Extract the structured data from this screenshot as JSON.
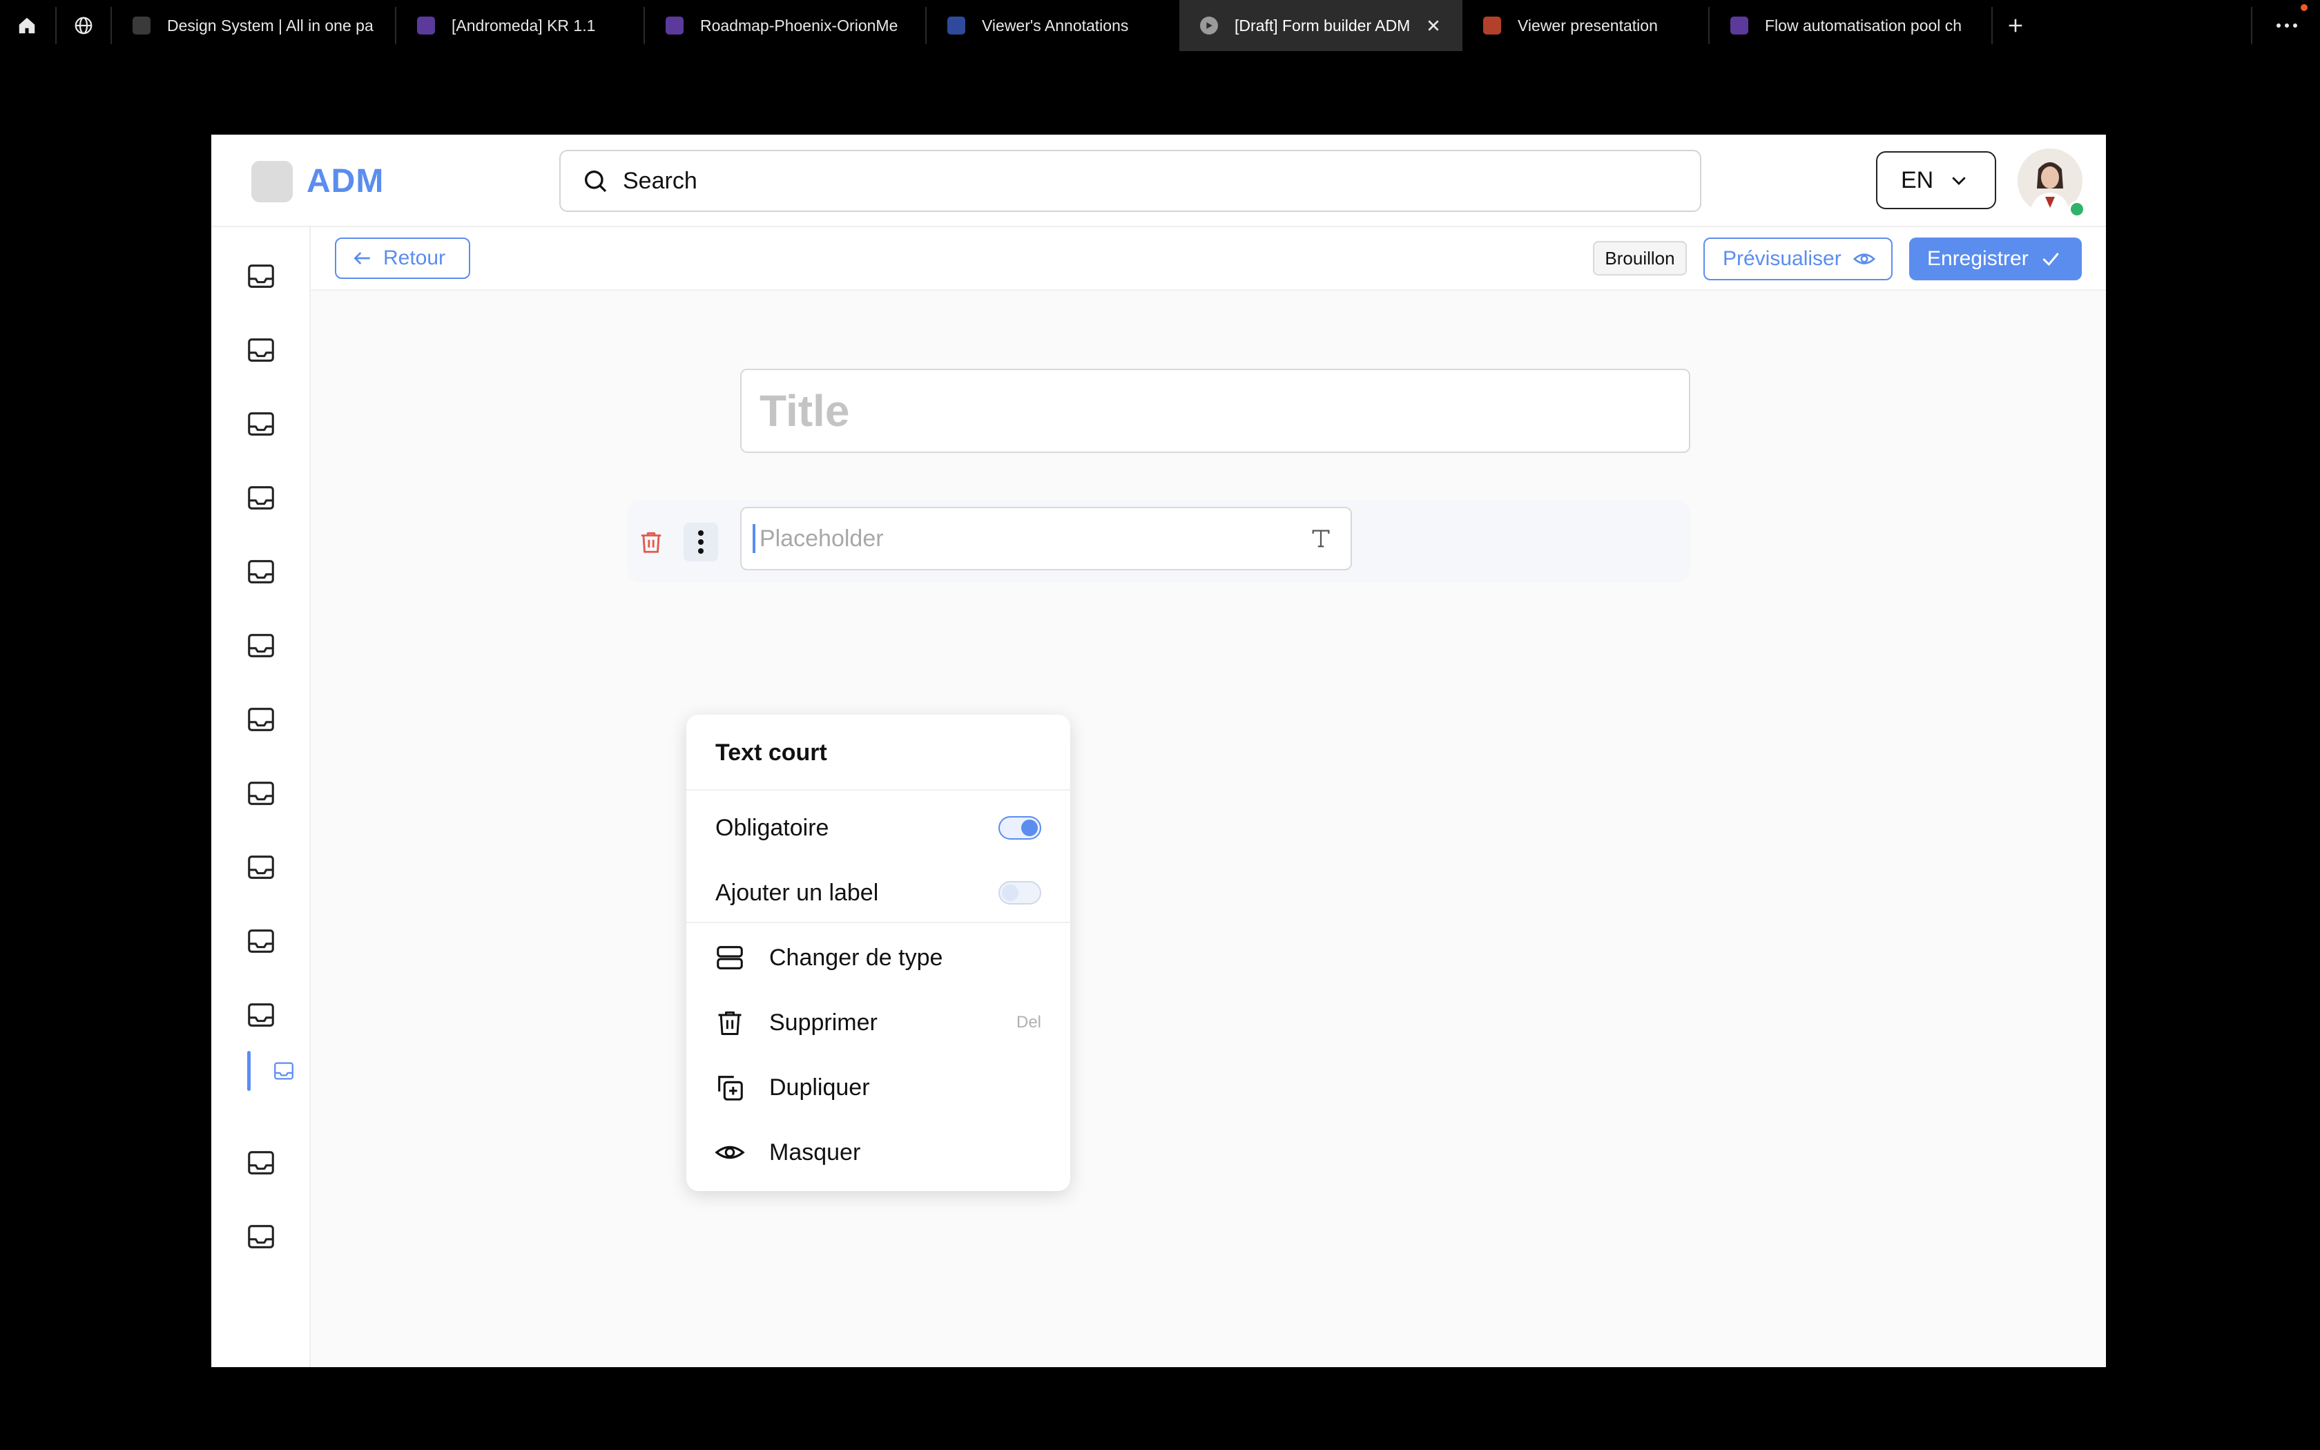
{
  "browser": {
    "tabs": [
      {
        "label": "Design System | All in one pa",
        "fav": "design-system-favicon",
        "color": "#3a3a3a"
      },
      {
        "label": "[Andromeda] KR 1.1",
        "fav": "figma-favicon",
        "color": "#5b3a9c"
      },
      {
        "label": "Roadmap-Phoenix-OrionMe",
        "fav": "figma-favicon",
        "color": "#5b3a9c"
      },
      {
        "label": "Viewer's Annotations",
        "fav": "jam-favicon",
        "color": "#2f4a9a"
      },
      {
        "label": "[Draft] Form builder ADM",
        "fav": "play-favicon",
        "color": "#9a9a9a"
      },
      {
        "label": "Viewer presentation",
        "fav": "slides-favicon",
        "color": "#b3412a"
      },
      {
        "label": "Flow automatisation pool ch",
        "fav": "figma-favicon",
        "color": "#5b3a9c"
      }
    ]
  },
  "header": {
    "logo_text": "ADM",
    "search_placeholder": "Search",
    "language": "EN"
  },
  "toolbar": {
    "back_label": "Retour",
    "status_badge": "Brouillon",
    "preview_label": "Prévisualiser",
    "save_label": "Enregistrer"
  },
  "form": {
    "title_placeholder": "Title",
    "field_placeholder": "Placeholder"
  },
  "menu": {
    "title": "Text court",
    "required_label": "Obligatoire",
    "required_on": true,
    "add_label_label": "Ajouter un label",
    "add_label_on": false,
    "change_type_label": "Changer de type",
    "delete_label": "Supprimer",
    "delete_shortcut": "Del",
    "duplicate_label": "Dupliquer",
    "hide_label": "Masquer"
  },
  "colors": {
    "accent": "#5b8def",
    "danger": "#e05a4a",
    "online": "#2fb36a"
  }
}
